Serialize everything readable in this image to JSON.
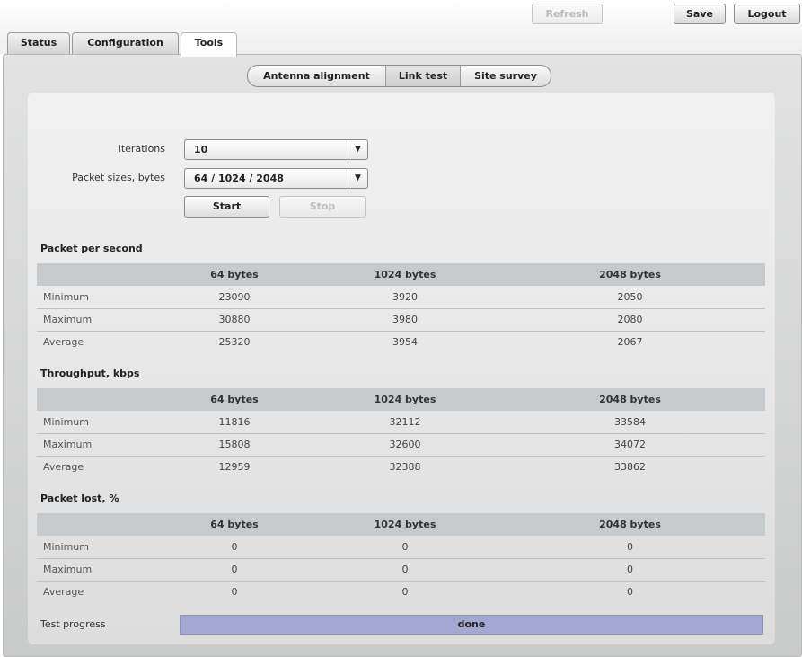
{
  "toolbar": {
    "refresh_label": "Refresh",
    "save_label": "Save",
    "logout_label": "Logout"
  },
  "tabs": [
    {
      "label": "Status",
      "active": false
    },
    {
      "label": "Configuration",
      "active": false
    },
    {
      "label": "Tools",
      "active": true
    }
  ],
  "subtabs": [
    {
      "label": "Antenna alignment",
      "active": false
    },
    {
      "label": "Link test",
      "active": true
    },
    {
      "label": "Site survey",
      "active": false
    }
  ],
  "form": {
    "iterations_label": "Iterations",
    "iterations_value": "10",
    "packet_sizes_label": "Packet sizes, bytes",
    "packet_sizes_value": "64 / 1024 / 2048",
    "start_label": "Start",
    "stop_label": "Stop"
  },
  "sections": [
    {
      "title": "Packet per second",
      "columns": [
        "",
        "64 bytes",
        "1024 bytes",
        "2048 bytes"
      ],
      "rows": [
        [
          "Minimum",
          "23090",
          "3920",
          "2050"
        ],
        [
          "Maximum",
          "30880",
          "3980",
          "2080"
        ],
        [
          "Average",
          "25320",
          "3954",
          "2067"
        ]
      ]
    },
    {
      "title": "Throughput, kbps",
      "columns": [
        "",
        "64 bytes",
        "1024 bytes",
        "2048 bytes"
      ],
      "rows": [
        [
          "Minimum",
          "11816",
          "32112",
          "33584"
        ],
        [
          "Maximum",
          "15808",
          "32600",
          "34072"
        ],
        [
          "Average",
          "12959",
          "32388",
          "33862"
        ]
      ]
    },
    {
      "title": "Packet lost, %",
      "columns": [
        "",
        "64 bytes",
        "1024 bytes",
        "2048 bytes"
      ],
      "rows": [
        [
          "Minimum",
          "0",
          "0",
          "0"
        ],
        [
          "Maximum",
          "0",
          "0",
          "0"
        ],
        [
          "Average",
          "0",
          "0",
          "0"
        ]
      ]
    }
  ],
  "progress": {
    "label": "Test progress",
    "value_text": "done",
    "percent": 100
  },
  "colors": {
    "progress_fill": "#a3a8d2",
    "header_row": "#c7cacc"
  },
  "icons": {
    "dropdown": "chevron-down-icon"
  }
}
